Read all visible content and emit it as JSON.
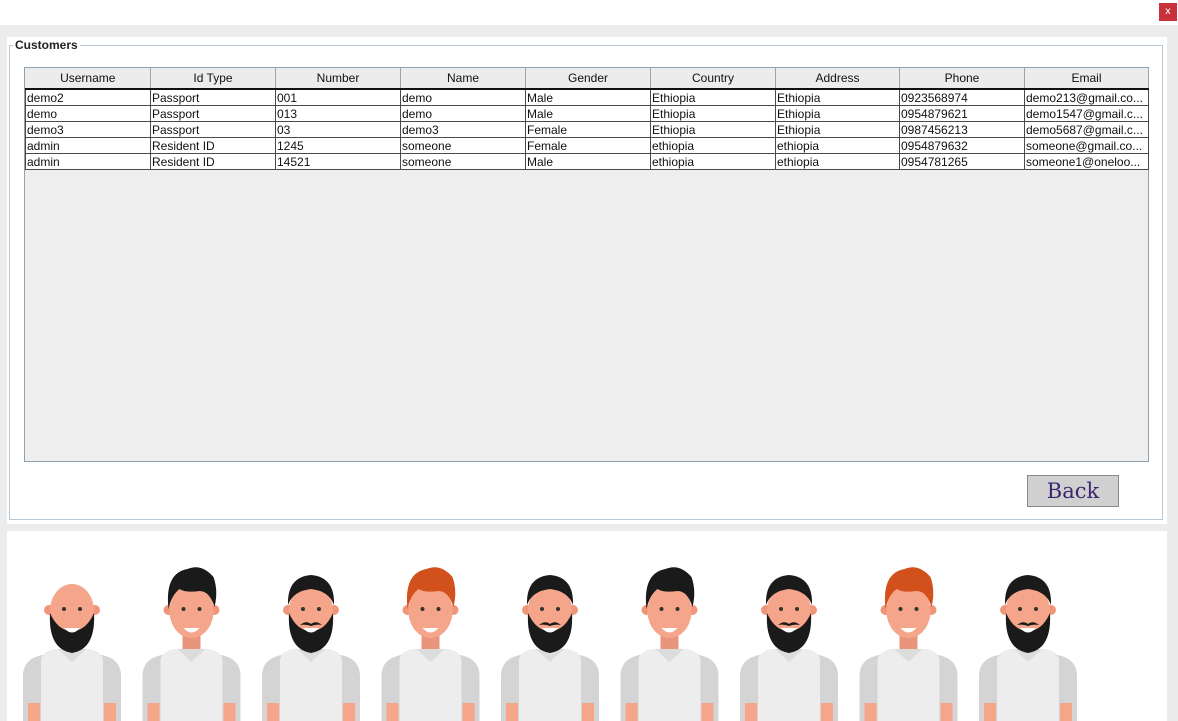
{
  "window": {
    "close_label": "x"
  },
  "group_title": "Customers",
  "table": {
    "columns": [
      "Username",
      "Id Type",
      "Number",
      "Name",
      "Gender",
      "Country",
      "Address",
      "Phone",
      "Email"
    ],
    "rows": [
      [
        "demo2",
        "Passport",
        "001",
        "demo",
        "Male",
        "Ethiopia",
        "Ethiopia",
        "0923568974",
        "demo213@gmail.co..."
      ],
      [
        "demo",
        "Passport",
        "013",
        "demo",
        "Male",
        "Ethiopia",
        "Ethiopia",
        "0954879621",
        "demo1547@gmail.c..."
      ],
      [
        "demo3",
        "Passport",
        "03",
        "demo3",
        "Female",
        "Ethiopia",
        "Ethiopia",
        "0987456213",
        "demo5687@gmail.c..."
      ],
      [
        "admin",
        "Resident ID",
        "1245",
        "someone",
        "Female",
        "ethiopia",
        "ethiopia",
        "0954879632",
        "someone@gmail.co..."
      ],
      [
        "admin",
        "Resident ID",
        "14521",
        "someone",
        "Male",
        "ethiopia",
        "ethiopia",
        "0954781265",
        "someone1@oneloo..."
      ]
    ]
  },
  "back_label": "Back",
  "illustration": {
    "avatars": [
      {
        "hair": "bald",
        "beard": "full",
        "hair_color": "#111111"
      },
      {
        "hair": "quiff",
        "beard": "none",
        "hair_color": "#1a1a1a"
      },
      {
        "hair": "short",
        "beard": "full-moustache",
        "hair_color": "#1a1a1a"
      },
      {
        "hair": "quiff",
        "beard": "none",
        "hair_color": "#d2501c"
      },
      {
        "hair": "short",
        "beard": "full-moustache",
        "hair_color": "#1a1a1a"
      },
      {
        "hair": "quiff",
        "beard": "none",
        "hair_color": "#1a1a1a"
      },
      {
        "hair": "short",
        "beard": "full-moustache",
        "hair_color": "#1a1a1a"
      },
      {
        "hair": "quiff",
        "beard": "none",
        "hair_color": "#d2501c"
      },
      {
        "hair": "short",
        "beard": "full-moustache",
        "hair_color": "#1a1a1a"
      }
    ],
    "skin_color": "#f4a58a",
    "shirt_color": "#ededed",
    "sleeve_color": "#d4d4d4"
  }
}
